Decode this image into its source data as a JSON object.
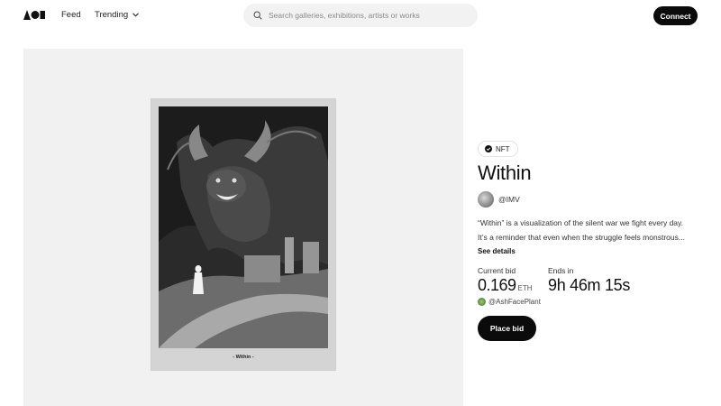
{
  "header": {
    "logo_icon": "brand-logo-icon",
    "nav": {
      "feed": "Feed",
      "trending": "Trending"
    },
    "search": {
      "placeholder": "Search galleries, exhibitions, artists or works",
      "value": ""
    },
    "connect_label": "Connect"
  },
  "artwork": {
    "caption": "- Within -"
  },
  "details": {
    "badge": "NFT",
    "title": "Within",
    "artist_handle": "@IMV",
    "description_lines": [
      "“Within” is a visualization of the silent war we fight every day.",
      "It’s a reminder that even when the struggle feels monstrous..."
    ],
    "see_details": "See details",
    "current_bid_label": "Current bid",
    "current_bid_value": "0.169",
    "current_bid_unit": "ETH",
    "ends_in_label": "Ends in",
    "ends_in_value": "9h 46m 15s",
    "top_bidder": "@AshFacePlant",
    "place_bid_label": "Place bid"
  },
  "colors": {
    "primary_button": "#0b0b0b",
    "panel_bg": "#f1f1f1",
    "search_bg": "#f2f2f2"
  }
}
